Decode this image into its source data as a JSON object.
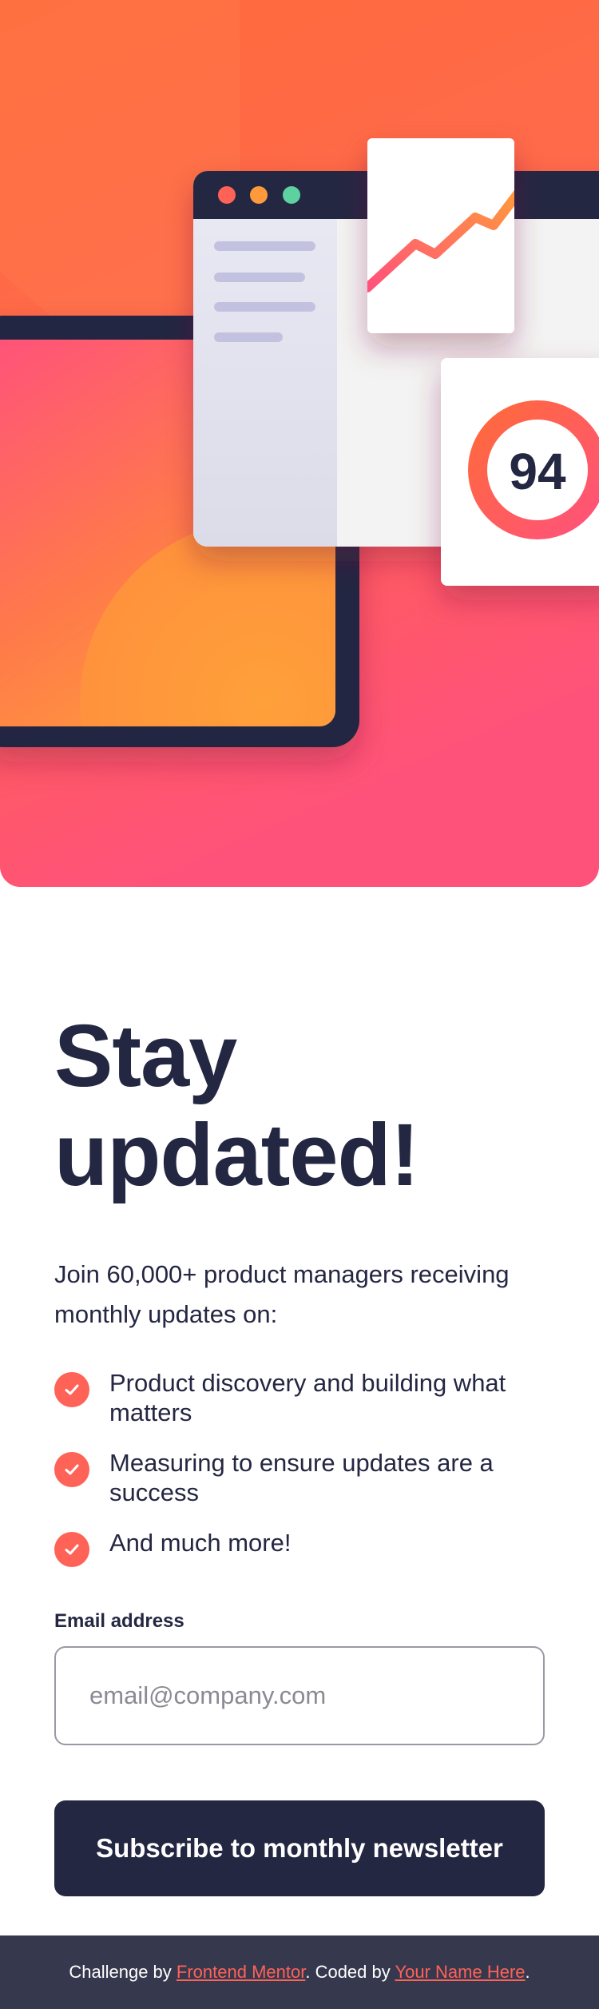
{
  "hero": {
    "score": "94",
    "colors": {
      "tomato": "#ff6257",
      "dark_navy": "#242742",
      "charcoal": "#36384e",
      "orange": "#ff9a3c",
      "pink": "#ff527b"
    }
  },
  "main": {
    "title_line1": "Stay",
    "title_line2": "updated!",
    "intro": "Join 60,000+ product managers receiving monthly updates on:",
    "features": [
      {
        "icon": "check-icon",
        "text": "Product discovery and building what matters"
      },
      {
        "icon": "check-icon",
        "text": "Measuring to ensure updates are a success"
      },
      {
        "icon": "check-icon",
        "text": "And much more!"
      }
    ]
  },
  "form": {
    "email_label": "Email address",
    "email_placeholder": "email@company.com",
    "email_value": "",
    "subscribe_label": "Subscribe to monthly newsletter"
  },
  "footer": {
    "prefix": "Challenge by ",
    "link1": "Frontend Mentor",
    "middle": ". Coded by ",
    "link2": "Your Name Here",
    "suffix": "."
  }
}
